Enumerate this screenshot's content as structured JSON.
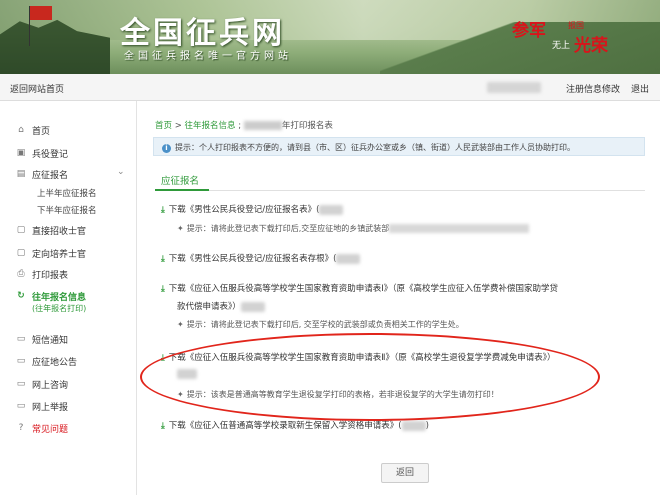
{
  "banner": {
    "title": "全国征兵网",
    "subtitle": "全国征兵报名唯一官方网站",
    "slogan_1": "参军",
    "slogan_2": "报国",
    "slogan_3": "无上",
    "slogan_4": "光荣"
  },
  "topbar": {
    "home_link": "返回网站首页",
    "modify_link": "注册信息修改",
    "logout_link": "退出"
  },
  "sidebar": {
    "items": [
      {
        "label": "首页",
        "icon": "home-icon"
      },
      {
        "label": "兵役登记",
        "icon": "register-icon"
      },
      {
        "label": "应征报名",
        "icon": "enlist-icon"
      },
      {
        "label": "直接招收士官",
        "icon": "document-icon"
      },
      {
        "label": "定向培养士官",
        "icon": "document-icon"
      },
      {
        "label": "打印报表",
        "icon": "printer-icon"
      },
      {
        "label": "往年报名信息",
        "icon": "refresh-icon"
      },
      {
        "label": "短信通知",
        "icon": "message-icon"
      },
      {
        "label": "应征地公告",
        "icon": "notice-icon"
      },
      {
        "label": "网上咨询",
        "icon": "chat-icon"
      },
      {
        "label": "网上举报",
        "icon": "report-icon"
      },
      {
        "label": "常见问题",
        "icon": "question-icon"
      }
    ],
    "sub_items": [
      "上半年应征报名",
      "下半年应征报名"
    ],
    "active_sub": "(往年报名打印)"
  },
  "main": {
    "breadcrumb_home": "首页",
    "breadcrumb_sep": ">",
    "breadcrumb_prev": "往年报名信息",
    "breadcrumb_current": "年打印报名表",
    "tip_label": "提示：",
    "tip_text": "个人打印报表不方便的，请到县（市、区）征兵办公室或乡（镇、街道）人民武装部由工作人员协助打印。",
    "tab": "应征报名",
    "downloads": [
      {
        "text": "下载《男性公民兵役登记/应征报名表》(",
        "hint": "提示：请将此登记表下载打印后,交至应征地的乡镇武装部"
      },
      {
        "text": "下载《男性公民兵役登记/应征报名表存根》(",
        "hint": ""
      },
      {
        "text": "下载《应征入伍服兵役高等学校学生国家教育资助申请表Ⅰ》（原《高校学生应征入伍学费补偿国家助学贷",
        "text2": "款代偿申请表》）",
        "hint": "提示：请将此登记表下载打印后, 交至学校的武装部或负责相关工作的学生处。"
      },
      {
        "text": "下载《应征入伍服兵役高等学校学生国家教育资助申请表Ⅱ》（原《高校学生退役复学学费减免申请表》）",
        "hint": "提示：该表是普通高等教育学生退役复学打印的表格，若非退役复学的大学生请勿打印！"
      },
      {
        "text": "下载《应征入伍普通高等学校录取新生保留入学资格申请表》(",
        "hint": ""
      }
    ],
    "close_paren": ")",
    "back_button": "返回"
  }
}
